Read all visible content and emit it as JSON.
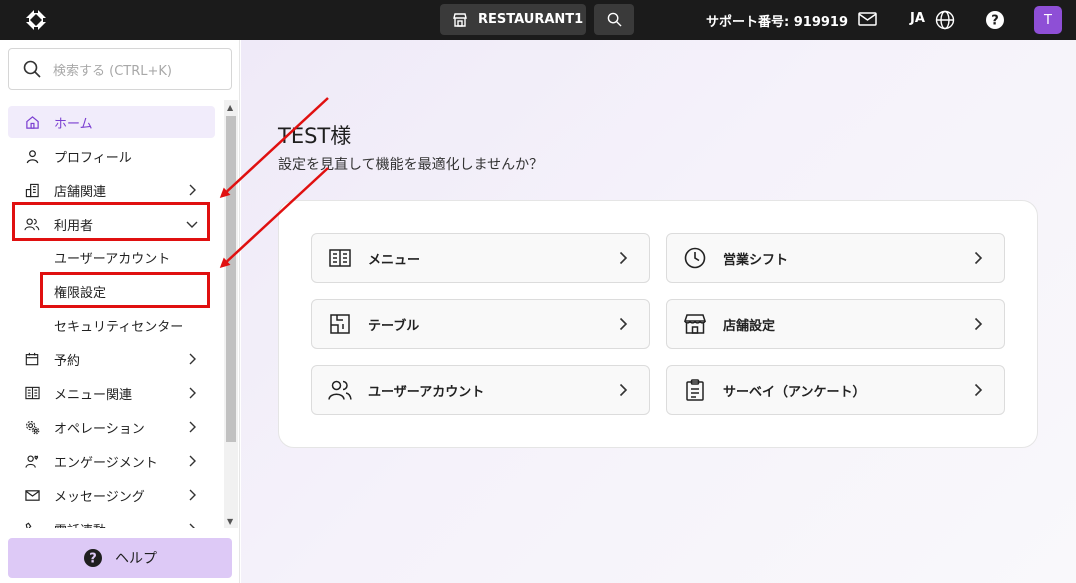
{
  "topbar": {
    "store_name": "RESTAURANT1",
    "support_label": "サポート番号: 919919",
    "language": "JA",
    "avatar_initial": "T"
  },
  "sidebar": {
    "search_placeholder": "検索する (CTRL+K)",
    "items": [
      {
        "label": "ホーム",
        "icon": "home-icon"
      },
      {
        "label": "プロフィール",
        "icon": "person-icon"
      },
      {
        "label": "店舗関連",
        "icon": "building-icon"
      },
      {
        "label": "利用者",
        "icon": "users-icon"
      },
      {
        "label": "予約",
        "icon": "calendar-icon"
      },
      {
        "label": "メニュー関連",
        "icon": "menu-book-icon"
      },
      {
        "label": "オペレーション",
        "icon": "gears-icon"
      },
      {
        "label": "エンゲージメント",
        "icon": "engagement-icon"
      },
      {
        "label": "メッセージング",
        "icon": "mail-icon"
      },
      {
        "label": "電話連動",
        "icon": "phone-icon"
      }
    ],
    "sub_items": [
      {
        "label": "ユーザーアカウント"
      },
      {
        "label": "権限設定"
      },
      {
        "label": "セキュリティセンター"
      }
    ],
    "help_label": "ヘルプ"
  },
  "main": {
    "greeting": "TEST様",
    "subtitle": "設定を見直して機能を最適化しませんか？",
    "tiles": [
      {
        "label": "メニュー",
        "icon": "menu-book-icon"
      },
      {
        "label": "営業シフト",
        "icon": "clock-icon"
      },
      {
        "label": "テーブル",
        "icon": "table-layout-icon"
      },
      {
        "label": "店舗設定",
        "icon": "storefront-icon"
      },
      {
        "label": "ユーザーアカウント",
        "icon": "users-icon"
      },
      {
        "label": "サーベイ（アンケート）",
        "icon": "clipboard-icon"
      }
    ]
  },
  "colors": {
    "accent": "#7b3fd1",
    "topbar_bg": "#1b1b1b",
    "highlight_red": "#e01010",
    "help_bg": "#ddc9f6"
  }
}
